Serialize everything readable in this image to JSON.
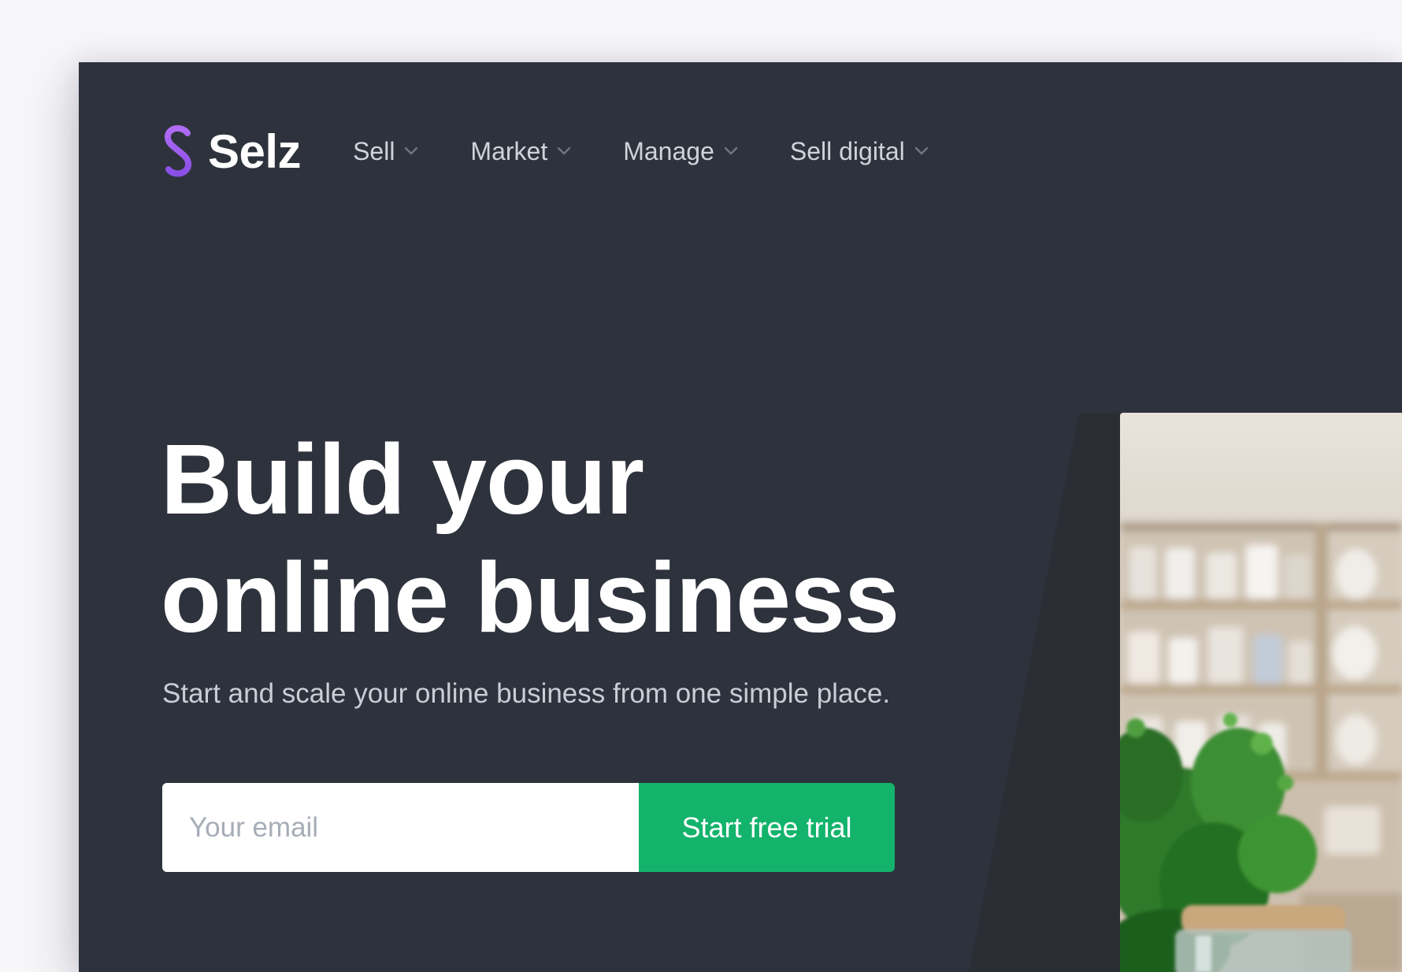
{
  "brand": {
    "name": "Selz",
    "accent_color": "#9b59f0"
  },
  "nav": {
    "items": [
      {
        "label": "Sell",
        "icon": "chevron-down-icon"
      },
      {
        "label": "Market",
        "icon": "chevron-down-icon"
      },
      {
        "label": "Manage",
        "icon": "chevron-down-icon"
      },
      {
        "label": "Sell digital",
        "icon": "chevron-down-icon"
      }
    ]
  },
  "hero": {
    "title_line1": "Build your",
    "title_line2": "online business",
    "subtitle": "Start and scale your online business from one simple place.",
    "email_placeholder": "Your email",
    "cta_label": "Start free trial",
    "cta_color": "#13b36c",
    "background_color": "#2e323c"
  }
}
